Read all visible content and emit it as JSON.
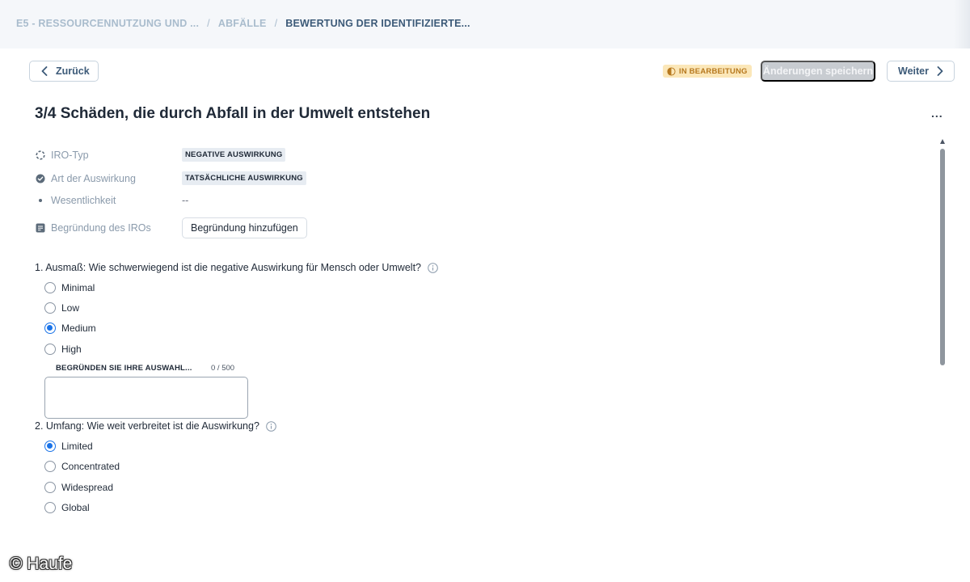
{
  "breadcrumb": {
    "items": [
      "E5 - RESSOURCENNUTZUNG UND ...",
      "ABFÄLLE"
    ],
    "separator": "/",
    "current": "BEWERTUNG DER IDENTIFIZIERTE..."
  },
  "toolbar": {
    "back_label": "Zurück",
    "status": "IN BEARBEITUNG",
    "save_label": "Änderungen speichern",
    "next_label": "Weiter"
  },
  "page": {
    "title": "3/4 Schäden, die durch Abfall in der Umwelt entstehen",
    "more": "..."
  },
  "meta": {
    "iro_type": {
      "label": "IRO-Typ",
      "value": "NEGATIVE AUSWIRKUNG",
      "icon": "dashed-circle-icon"
    },
    "impact_kind": {
      "label": "Art der Auswirkung",
      "value": "TATSÄCHLICHE AUSWIRKUNG",
      "icon": "check-circle-icon"
    },
    "materiality": {
      "label": "Wesentlichkeit",
      "value": "--",
      "icon": "dot-icon"
    },
    "justification": {
      "label": "Begründung des IROs",
      "button_label": "Begründung hinzufügen",
      "icon": "note-icon"
    }
  },
  "question1": {
    "text": "1. Ausmaß: Wie schwerwiegend ist die negative Auswirkung für Mensch oder Umwelt?",
    "options": [
      "Minimal",
      "Low",
      "Medium",
      "High"
    ],
    "selected": "Medium",
    "reason_label": "BEGRÜNDEN SIE IHRE AUSWAHL...",
    "reason_count": "0 / 500",
    "reason_value": ""
  },
  "question2": {
    "text": "2. Umfang: Wie weit verbreitet ist die Auswirkung?",
    "options": [
      "Limited",
      "Concentrated",
      "Widespread",
      "Global"
    ],
    "selected": "Limited"
  },
  "watermark": "© Haufe",
  "colors": {
    "accent": "#1a73e8",
    "link": "#3c5a78",
    "status_bg": "#fbe7b9",
    "status_text": "#b7791f",
    "disabled_button": "#c8ccd1"
  }
}
